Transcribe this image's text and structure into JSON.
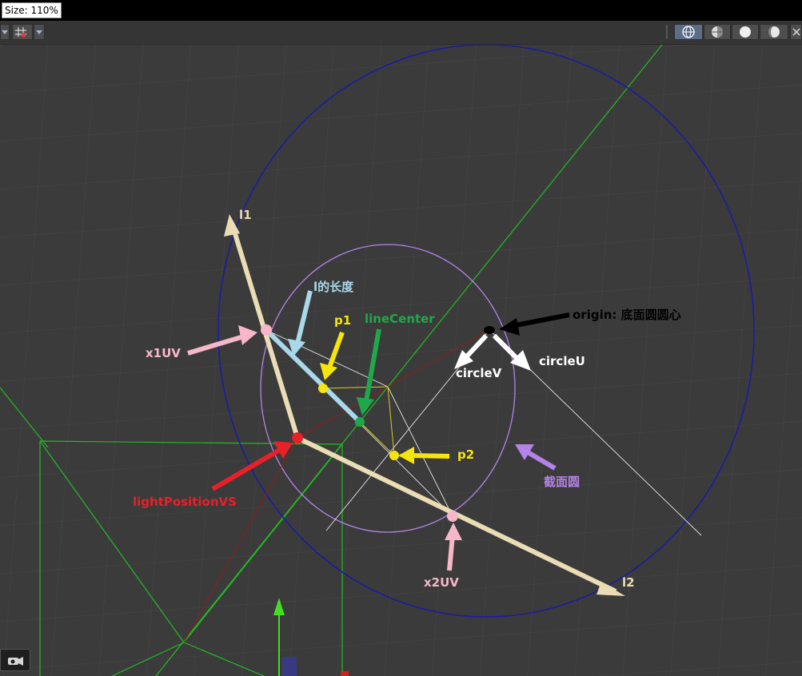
{
  "overlay": {
    "size_label": "Size: 110%"
  },
  "colors": {
    "background": "#3b3b3b",
    "grid": "#4a4a4a",
    "l_arrow": "#eadcb4",
    "l_length": "#a8d8ea",
    "x_uv": "#f7b7c8",
    "light_position": "#e8202a",
    "p_points": "#f5e50a",
    "line_center": "#1fa84a",
    "origin": "#000000",
    "circle_uv": "#ffffff",
    "section_circle": "#b383e8",
    "base_circle": "#1a1aa8",
    "axis_green": "#22bb22",
    "ray_red": "#8a1f1f"
  },
  "labels": {
    "l1": "l1",
    "l2": "l2",
    "l_length": "l的长度",
    "p1": "p1",
    "p2": "p2",
    "line_center": "lineCenter",
    "origin": "origin: 底面圆圆心",
    "circle_v": "circleV",
    "circle_u": "circleU",
    "x1uv": "x1UV",
    "x2uv": "x2UV",
    "light_position": "lightPositionVS",
    "section_circle": "截面圆"
  },
  "icons": {
    "grid_snap": "grid-snap-icon",
    "wireframe": "wireframe-sphere-icon",
    "shaded": "shaded-sphere-icon",
    "solid": "solid-sphere-icon",
    "material": "material-sphere-icon",
    "camera": "camera-icon",
    "gizmo": "move-gizmo-icon"
  }
}
